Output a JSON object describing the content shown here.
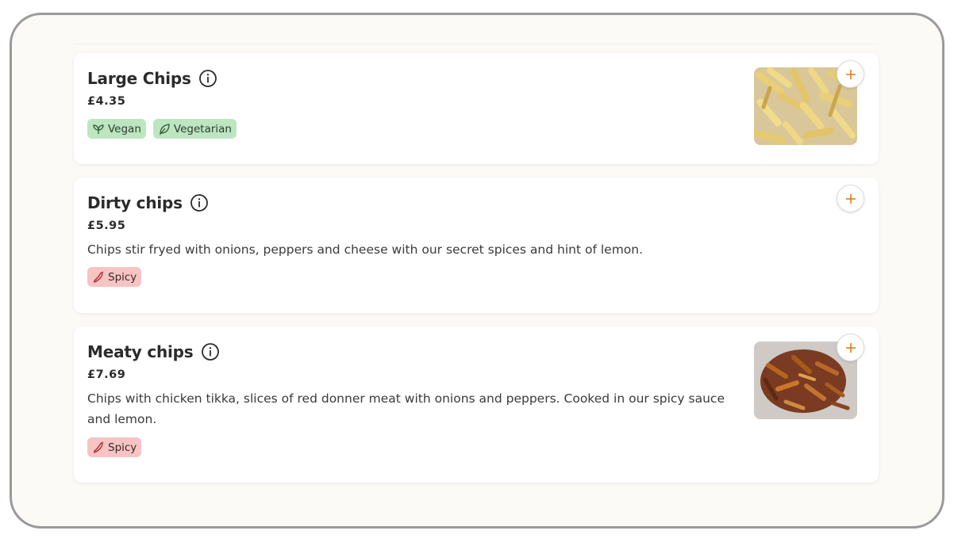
{
  "items": [
    {
      "name": "Large Chips",
      "price": "£4.35",
      "description": "",
      "tags": [
        "Vegan",
        "Vegetarian"
      ],
      "has_image": true
    },
    {
      "name": "Dirty chips",
      "price": "£5.95",
      "description": "Chips stir fryed with onions, peppers and cheese with our secret spices and hint of lemon.",
      "tags": [
        "Spicy"
      ],
      "has_image": false
    },
    {
      "name": "Meaty chips",
      "price": "£7.69",
      "description": "Chips with chicken tikka, slices of red donner meat with onions and peppers. Cooked in our spicy sauce and lemon.",
      "tags": [
        "Spicy"
      ],
      "has_image": true
    }
  ],
  "colors": {
    "accent": "#e07b1a",
    "tag_green": "#bde6c0",
    "tag_red": "#f8c3c3",
    "background": "#fbfaf7"
  },
  "icons": {
    "info": "info-icon",
    "add": "plus-icon",
    "vegan": "vegan-leaf-icon",
    "vegetarian": "leaf-icon",
    "spicy": "chili-icon"
  }
}
